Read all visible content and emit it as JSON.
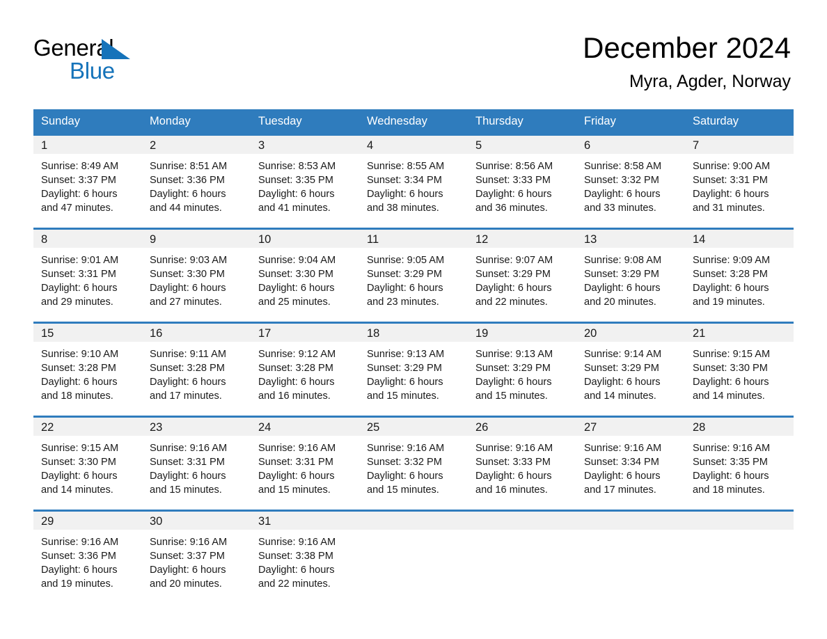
{
  "brand": {
    "name_part1": "General",
    "name_part2": "Blue",
    "triangle_icon": "brand-triangle-icon",
    "accent_color": "#1573ba"
  },
  "header": {
    "month_title": "December 2024",
    "location": "Myra, Agder, Norway"
  },
  "theme": {
    "header_blue": "#2f7cbd",
    "daynum_band": "#f1f1f1",
    "text": "#1a1a1a"
  },
  "weekday_headers": [
    "Sunday",
    "Monday",
    "Tuesday",
    "Wednesday",
    "Thursday",
    "Friday",
    "Saturday"
  ],
  "weeks": [
    [
      {
        "day": "1",
        "sunrise": "Sunrise: 8:49 AM",
        "sunset": "Sunset: 3:37 PM",
        "daylight_line1": "Daylight: 6 hours",
        "daylight_line2": "and 47 minutes."
      },
      {
        "day": "2",
        "sunrise": "Sunrise: 8:51 AM",
        "sunset": "Sunset: 3:36 PM",
        "daylight_line1": "Daylight: 6 hours",
        "daylight_line2": "and 44 minutes."
      },
      {
        "day": "3",
        "sunrise": "Sunrise: 8:53 AM",
        "sunset": "Sunset: 3:35 PM",
        "daylight_line1": "Daylight: 6 hours",
        "daylight_line2": "and 41 minutes."
      },
      {
        "day": "4",
        "sunrise": "Sunrise: 8:55 AM",
        "sunset": "Sunset: 3:34 PM",
        "daylight_line1": "Daylight: 6 hours",
        "daylight_line2": "and 38 minutes."
      },
      {
        "day": "5",
        "sunrise": "Sunrise: 8:56 AM",
        "sunset": "Sunset: 3:33 PM",
        "daylight_line1": "Daylight: 6 hours",
        "daylight_line2": "and 36 minutes."
      },
      {
        "day": "6",
        "sunrise": "Sunrise: 8:58 AM",
        "sunset": "Sunset: 3:32 PM",
        "daylight_line1": "Daylight: 6 hours",
        "daylight_line2": "and 33 minutes."
      },
      {
        "day": "7",
        "sunrise": "Sunrise: 9:00 AM",
        "sunset": "Sunset: 3:31 PM",
        "daylight_line1": "Daylight: 6 hours",
        "daylight_line2": "and 31 minutes."
      }
    ],
    [
      {
        "day": "8",
        "sunrise": "Sunrise: 9:01 AM",
        "sunset": "Sunset: 3:31 PM",
        "daylight_line1": "Daylight: 6 hours",
        "daylight_line2": "and 29 minutes."
      },
      {
        "day": "9",
        "sunrise": "Sunrise: 9:03 AM",
        "sunset": "Sunset: 3:30 PM",
        "daylight_line1": "Daylight: 6 hours",
        "daylight_line2": "and 27 minutes."
      },
      {
        "day": "10",
        "sunrise": "Sunrise: 9:04 AM",
        "sunset": "Sunset: 3:30 PM",
        "daylight_line1": "Daylight: 6 hours",
        "daylight_line2": "and 25 minutes."
      },
      {
        "day": "11",
        "sunrise": "Sunrise: 9:05 AM",
        "sunset": "Sunset: 3:29 PM",
        "daylight_line1": "Daylight: 6 hours",
        "daylight_line2": "and 23 minutes."
      },
      {
        "day": "12",
        "sunrise": "Sunrise: 9:07 AM",
        "sunset": "Sunset: 3:29 PM",
        "daylight_line1": "Daylight: 6 hours",
        "daylight_line2": "and 22 minutes."
      },
      {
        "day": "13",
        "sunrise": "Sunrise: 9:08 AM",
        "sunset": "Sunset: 3:29 PM",
        "daylight_line1": "Daylight: 6 hours",
        "daylight_line2": "and 20 minutes."
      },
      {
        "day": "14",
        "sunrise": "Sunrise: 9:09 AM",
        "sunset": "Sunset: 3:28 PM",
        "daylight_line1": "Daylight: 6 hours",
        "daylight_line2": "and 19 minutes."
      }
    ],
    [
      {
        "day": "15",
        "sunrise": "Sunrise: 9:10 AM",
        "sunset": "Sunset: 3:28 PM",
        "daylight_line1": "Daylight: 6 hours",
        "daylight_line2": "and 18 minutes."
      },
      {
        "day": "16",
        "sunrise": "Sunrise: 9:11 AM",
        "sunset": "Sunset: 3:28 PM",
        "daylight_line1": "Daylight: 6 hours",
        "daylight_line2": "and 17 minutes."
      },
      {
        "day": "17",
        "sunrise": "Sunrise: 9:12 AM",
        "sunset": "Sunset: 3:28 PM",
        "daylight_line1": "Daylight: 6 hours",
        "daylight_line2": "and 16 minutes."
      },
      {
        "day": "18",
        "sunrise": "Sunrise: 9:13 AM",
        "sunset": "Sunset: 3:29 PM",
        "daylight_line1": "Daylight: 6 hours",
        "daylight_line2": "and 15 minutes."
      },
      {
        "day": "19",
        "sunrise": "Sunrise: 9:13 AM",
        "sunset": "Sunset: 3:29 PM",
        "daylight_line1": "Daylight: 6 hours",
        "daylight_line2": "and 15 minutes."
      },
      {
        "day": "20",
        "sunrise": "Sunrise: 9:14 AM",
        "sunset": "Sunset: 3:29 PM",
        "daylight_line1": "Daylight: 6 hours",
        "daylight_line2": "and 14 minutes."
      },
      {
        "day": "21",
        "sunrise": "Sunrise: 9:15 AM",
        "sunset": "Sunset: 3:30 PM",
        "daylight_line1": "Daylight: 6 hours",
        "daylight_line2": "and 14 minutes."
      }
    ],
    [
      {
        "day": "22",
        "sunrise": "Sunrise: 9:15 AM",
        "sunset": "Sunset: 3:30 PM",
        "daylight_line1": "Daylight: 6 hours",
        "daylight_line2": "and 14 minutes."
      },
      {
        "day": "23",
        "sunrise": "Sunrise: 9:16 AM",
        "sunset": "Sunset: 3:31 PM",
        "daylight_line1": "Daylight: 6 hours",
        "daylight_line2": "and 15 minutes."
      },
      {
        "day": "24",
        "sunrise": "Sunrise: 9:16 AM",
        "sunset": "Sunset: 3:31 PM",
        "daylight_line1": "Daylight: 6 hours",
        "daylight_line2": "and 15 minutes."
      },
      {
        "day": "25",
        "sunrise": "Sunrise: 9:16 AM",
        "sunset": "Sunset: 3:32 PM",
        "daylight_line1": "Daylight: 6 hours",
        "daylight_line2": "and 15 minutes."
      },
      {
        "day": "26",
        "sunrise": "Sunrise: 9:16 AM",
        "sunset": "Sunset: 3:33 PM",
        "daylight_line1": "Daylight: 6 hours",
        "daylight_line2": "and 16 minutes."
      },
      {
        "day": "27",
        "sunrise": "Sunrise: 9:16 AM",
        "sunset": "Sunset: 3:34 PM",
        "daylight_line1": "Daylight: 6 hours",
        "daylight_line2": "and 17 minutes."
      },
      {
        "day": "28",
        "sunrise": "Sunrise: 9:16 AM",
        "sunset": "Sunset: 3:35 PM",
        "daylight_line1": "Daylight: 6 hours",
        "daylight_line2": "and 18 minutes."
      }
    ],
    [
      {
        "day": "29",
        "sunrise": "Sunrise: 9:16 AM",
        "sunset": "Sunset: 3:36 PM",
        "daylight_line1": "Daylight: 6 hours",
        "daylight_line2": "and 19 minutes."
      },
      {
        "day": "30",
        "sunrise": "Sunrise: 9:16 AM",
        "sunset": "Sunset: 3:37 PM",
        "daylight_line1": "Daylight: 6 hours",
        "daylight_line2": "and 20 minutes."
      },
      {
        "day": "31",
        "sunrise": "Sunrise: 9:16 AM",
        "sunset": "Sunset: 3:38 PM",
        "daylight_line1": "Daylight: 6 hours",
        "daylight_line2": "and 22 minutes."
      },
      {
        "day": "",
        "sunrise": "",
        "sunset": "",
        "daylight_line1": "",
        "daylight_line2": ""
      },
      {
        "day": "",
        "sunrise": "",
        "sunset": "",
        "daylight_line1": "",
        "daylight_line2": ""
      },
      {
        "day": "",
        "sunrise": "",
        "sunset": "",
        "daylight_line1": "",
        "daylight_line2": ""
      },
      {
        "day": "",
        "sunrise": "",
        "sunset": "",
        "daylight_line1": "",
        "daylight_line2": ""
      }
    ]
  ]
}
